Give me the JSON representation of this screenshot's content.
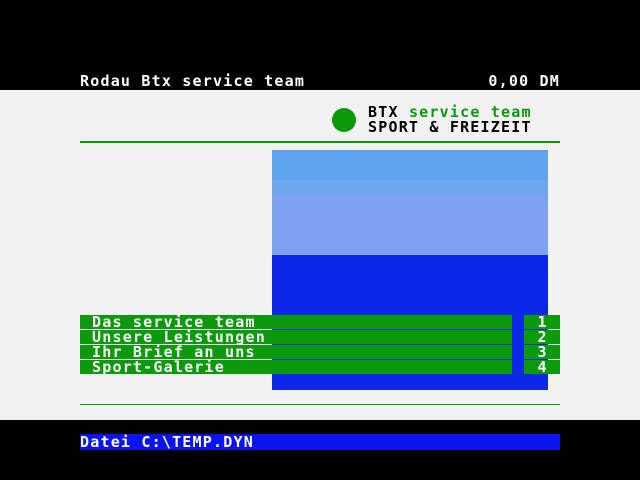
{
  "header": {
    "title": "Rodau Btx service team",
    "price": "0,00 DM"
  },
  "brand": {
    "btx": "BTX",
    "service_team": "service team",
    "subtitle": "SPORT & FREIZEIT"
  },
  "menu": {
    "items": [
      {
        "label": "Das service team",
        "number": "1"
      },
      {
        "label": "Unsere Leistungen",
        "number": "2"
      },
      {
        "label": "Ihr Brief an uns",
        "number": "3"
      },
      {
        "label": "Sport-Galerie",
        "number": "4"
      }
    ]
  },
  "status": {
    "text": "Datei C:\\TEMP.DYN"
  },
  "colors": {
    "green": "#0b9a0b",
    "sky": "#7fa2f0",
    "sea": "#0c28e6",
    "status_blue": "#0a14f0",
    "page_bg": "#f2f2f2"
  }
}
